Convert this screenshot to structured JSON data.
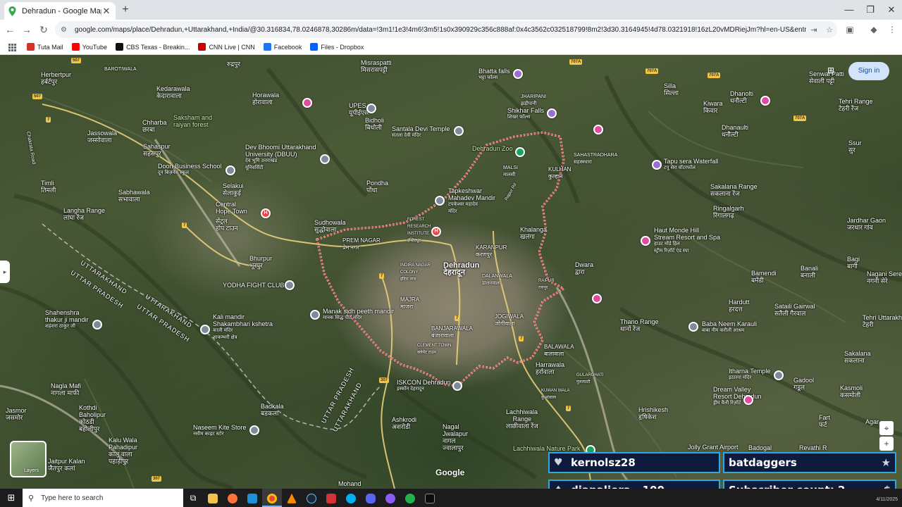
{
  "browser": {
    "tab_title": "Dehradun - Google Maps",
    "tab_close": "✕",
    "new_tab": "+",
    "url": "google.com/maps/place/Dehradun,+Uttarakhand,+India/@30.316834,78.0246878,30286m/data=!3m1!1e3!4m6!3m5!1s0x390929c356c888af:0x4c3562c032518799!8m2!3d30.3164945!4d78.0321918!16zL20vMDRiejJm?hl=en-US&entry=ttu&g_ep=Eg...",
    "bookmarks": [
      {
        "label": "Tuta Mail",
        "color": "#d93025"
      },
      {
        "label": "YouTube",
        "color": "#ff0000"
      },
      {
        "label": "CBS Texas - Breakin...",
        "color": "#111111"
      },
      {
        "label": "CNN Live | CNN",
        "color": "#cc0000"
      },
      {
        "label": "Facebook",
        "color": "#1877f2"
      },
      {
        "label": "Files - Dropbox",
        "color": "#0061fe"
      }
    ]
  },
  "map": {
    "sign_in": "Sign in",
    "layers_label": "Layers",
    "google_logo": "Google",
    "places": {
      "herbertpur": "Herbertpur",
      "herbertpur_h": "हर्बर्टपुर",
      "barotiwala": "BAROTIWALA",
      "kedarawala": "Kedarawala",
      "kedarawala_h": "केदारावाला",
      "horawala": "Horawala",
      "horawala_h": "होरावाला",
      "rudrapur": "रुद्रपुर",
      "misraspatti": "Misraspatti",
      "misraspatti_h": "मिसरासपट्टी",
      "upes": "UPES",
      "upes_h": "यूपीईएस",
      "bhatta_falls": "Bhatta falls",
      "bhatta_falls_h": "भट्टा फॉल्स",
      "jharipani": "JHARIPANI",
      "jharipani_h": "झड़ीपानी",
      "shikhar_falls": "Shikhar Falls",
      "shikhar_falls_h": "शिखर फॉल्स",
      "silla": "Silla",
      "silla_h": "सिल्ला",
      "kiwara": "Kiwara",
      "kiwara_h": "किवार",
      "dhanolti": "Dhanolti",
      "dhanolti_h": "धनौल्टी",
      "senwal_patti": "Senwal Patti",
      "senwal_patti_h": "सेवाली पट्टी",
      "tehri_range": "Tehri Range",
      "tehri_range_h": "टेहरी रेंज",
      "dhanaulti": "Dhanaulti",
      "dhanaulti_h": "धनौल्टी",
      "ssur": "Ssur",
      "ssur_h": "सुर",
      "chharba": "Chharba",
      "chharba_h": "छरबा",
      "saksham": "Saksham and",
      "saksham2": "raiyan forest",
      "jassowala": "Jassowala",
      "jassowala_h": "जस्सोवाला",
      "bidholi": "Bidholi",
      "bidholi_h": "बिधोली",
      "santala": "Santala Devi Temple",
      "santala_h": "संतला देवी मंदिर",
      "dehradun_zoo": "Dehradun Zoo",
      "malsi": "MALSI",
      "malsi_h": "मालसी",
      "kulhan": "KULHAN",
      "kulhan_h": "कुल्हान",
      "sahastradhara": "SAHASTRADHARA",
      "sahastradhara_h": "सहस्त्रधारा",
      "tapu_sera": "Tapu sera Waterfall",
      "tapu_sera_h": "टपू सेरा वॉटरफॉल",
      "sahaspur": "Sahaspur",
      "sahaspur_h": "सहसपुर",
      "dev_bhoomi": "Dev Bhoomi Uttarakhand",
      "dev_bhoomi2": "University (DBUU)",
      "dev_bhoomi_h": "देव भूमि उत्तराखंड",
      "dev_bhoomi_h2": "यूनिवर्सिटी",
      "doon_business": "Doon Business School",
      "doon_business_h": "दून बिज़नेस स्कूल",
      "pondha": "Pondha",
      "pondha_h": "पोंधा",
      "tapkeshwar": "Tapkeshwar",
      "tapkeshwar2": "Mahadev Mandir",
      "tapkeshwar_h": "टपकेश्वर महादेव",
      "tapkeshwar_h2": "मंदिर",
      "sakalana_range": "Sakalana Range",
      "sakalana_range_h": "सकलाना रेंज",
      "timli": "Timli",
      "timli_h": "तिमली",
      "selakui": "Selakui",
      "selakui_h": "सेलाकुई",
      "central_hope": "Central",
      "central_hope2": "Hope Town",
      "central_hope_h": "सेंट्रल",
      "central_hope_h2": "होप टाउन",
      "sabhawala": "Sabhawala",
      "sabhawala_h": "सभावाला",
      "langha": "Langha Range",
      "langha_h": "लांघा रेंज",
      "ringalgarh": "Ringalgarh",
      "ringalgarh_h": "रिंगालगढ़",
      "jardhar": "Jardhar Gaon",
      "jardhar_h": "जरधार गांव",
      "sudhowala": "Sudhowala",
      "sudhowala_h": "सुद्धोवाला",
      "forest_inst": "FOREST",
      "forest_inst2": "RESEARCH",
      "forest_inst3": "INSTITUTE",
      "forest_inst_h": "इंस्टिट्यूट",
      "khalanga": "Khalanga",
      "khalanga_h": "खलंगा",
      "haut_monde": "Haut Monde Hill",
      "haut_monde2": "Stream Resort and Spa",
      "haut_monde_h": "हाउट मोंडे हिल",
      "haut_monde_h2": "स्ट्रीम रिज़ॉर्ट एंड स्पा",
      "prem_nagar": "PREM NAGAR",
      "prem_nagar_h": "प्रेम नगर",
      "karanpur": "KARANPUR",
      "karanpur_h": "करणपुर",
      "dehradun": "Dehradun",
      "dehradun_h": "देहरादून",
      "indira": "INDIRA NAGAR",
      "indira2": "COLONY",
      "indira_h": "इंदिरा नगर",
      "dalanwala": "DALANWALA",
      "dalanwala_h": "डालनवाला",
      "raipur": "RAIPUR",
      "raipur_h": "रायपुर",
      "dwara": "Dwara",
      "dwara_h": "द्वारा",
      "bagi": "Bagi",
      "bagi_h": "बागी",
      "bamendi": "Bamendi",
      "bamendi_h": "बमेंडी",
      "banali": "Banali",
      "banali_h": "बनाली",
      "nagani": "Nagani Sere",
      "nagani_h": "नगनी सेरे",
      "bhurpur": "Bhurpur",
      "bhurpur_h": "भूरपुर",
      "yodha": "YODHA FIGHT CLUB",
      "uttarakhand_border": "UTTARAKHAND",
      "uttar_pradesh_border": "UTTAR PRADESH",
      "uttar_pradesh_border2": "UTTAR PRADESH",
      "uttarakhand_border2": "UTTARAKHAND",
      "majra": "MAJRA",
      "majra_h": "माजरा",
      "manak_sidh": "Manak sidh peeth mandir",
      "manak_sidh_h": "मानक सिद्ध पीठ मंदिर",
      "jogiwala": "JOGIWALA",
      "jogiwala_h": "जोगीवाला",
      "hardutt": "Hardutt",
      "hardutt_h": "हरदत्त",
      "satali": "Sataili Gairwal",
      "satali_h": "सतैली गैरवाल",
      "thano": "Thano Range",
      "thano_h": "थानों रेंज",
      "baba_neem": "Baba Neem Karauli",
      "baba_neem_h": "बाबा नीम करौली आश्रम",
      "tehri_village": "Tehri Uttarakhand",
      "tehri_village_h": "टेहरी",
      "shahenshra": "Shahenshra",
      "shahenshra2": "thakur ji mandir",
      "shahenshra_h": "शहंशरा ठाकुर जी",
      "kali_mandir": "Kali mandir",
      "kali_mandir2": "Shakambhari kshetra",
      "kali_mandir_h": "काली मंदिर",
      "kali_mandir_h2": "शाकम्भरी क्षेत्र",
      "banjarawala": "BANJARAWALA",
      "banjarawala_h": "बंजारावाला",
      "clement": "CLEMENT TOWN",
      "clement_h": "क्लेमेंट टाउन",
      "balawala": "BALAWALA",
      "balawala_h": "बालावाला",
      "harrawala": "Harrawala",
      "harrawala_h": "हर्रावाला",
      "gularghati": "GULARGHATI",
      "gularghati_h": "गुलरघाटी",
      "kuwan": "KUWAN WALA",
      "kuwan_h": "कुआंवाला",
      "iskcon": "ISKCON Dehradun",
      "iskcon_h": "इस्कॉन देहरादून",
      "itharna": "Itharna Temple",
      "itharna_h": "इठारना मंदिर",
      "gadool": "Gadool",
      "gadool_h": "गडूल",
      "sakalana": "Sakalana",
      "sakalana_h": "सकलाना",
      "kasmoli": "Kasmoli",
      "kasmoli_h": "कसमोली",
      "dream_valley": "Dream Valley",
      "dream_valley2": "Resort Dehradun",
      "dream_valley_h": "ड्रीम वैली रिज़ॉर्ट",
      "nagla_mafi": "Nagla Mafi",
      "nagla_mafi_h": "नागला माफी",
      "hrishikesh": "Hrishikesh",
      "hrishikesh_h": "हृषिकेश",
      "fart": "Fart",
      "fart_h": "फर्ट",
      "agar": "Agar",
      "kothdi": "Kothdi",
      "kothdi2": "Baholipur",
      "kothdi_h": "कोठडी",
      "kothdi_h2": "बहोलीपुर",
      "jasmor": "Jasmor",
      "jasmor_h": "जसमोर",
      "badkala": "Badkala",
      "badkala_h": "बडकला",
      "ashkrodi": "Ashkrodi",
      "ashkrodi_h": "अशरोडी",
      "lachhiwala": "Lachhiwala",
      "lachhiwala2": "Range",
      "lachhiwala_h": "लाछीवाला रेंज",
      "nagal": "Nagal",
      "nagal2": "Jwalapur",
      "nagal_h": "नागल",
      "nagal_h2": "ज्वालापुर",
      "kalu_wala": "Kalu Wala",
      "kalu_wala2": "Pahadipur",
      "kalu_wala_h": "कालू वाला",
      "kalu_wala_h2": "पहाड़ीपुर",
      "naseem": "Naseem Kite Store",
      "naseem_h": "नसीम काइट स्टोर",
      "jaitpur": "Jaitpur Kalan",
      "jaitpur_h": "जैतपुर कलां",
      "lachhiwala_park": "Lachhiwala Nature Park",
      "jolly_grant": "Jolly Grant Airport",
      "badogal": "Badogal",
      "revathi": "Revathi R",
      "mohand": "Mohand",
      "chakrata_road": "Chakrata Road",
      "rajpur_road": "Rajpur Rd"
    },
    "shields": {
      "s507": "507",
      "s7": "7",
      "s707a": "707A",
      "s307": "307"
    }
  },
  "overlay": {
    "follower": "kernolsz28",
    "host": "batdaggers",
    "donation": "dianaliora - 100",
    "subscriber": "Subscriber count: 2",
    "heart_icon": "♥",
    "star_icon": "★",
    "drop_icon": "♦",
    "dollar_icon": "$"
  },
  "taskbar": {
    "search_placeholder": "Type here to search",
    "clock": "4/11/2025"
  },
  "colors": {
    "overlay_bg": "#0e1b3d",
    "overlay_border": "#2ea7e0",
    "signin_bg": "#d2e3fc",
    "boundary": "#f05a5a"
  }
}
